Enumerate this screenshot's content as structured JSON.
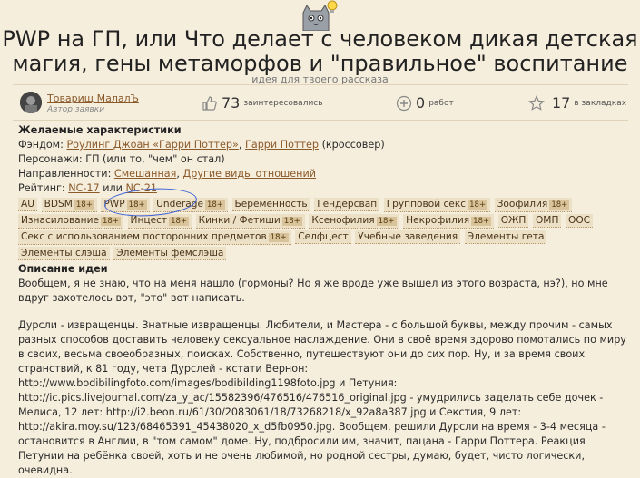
{
  "header": {
    "title": "PWP на ГП, или Что делает с человеком дикая детская магия, гены метаморфов и \"правильное\" воспитание",
    "subtitle": "идея для твоего рассказа"
  },
  "author": {
    "name": "Товарищ МалалЪ",
    "role": "Автор заявки"
  },
  "stats": {
    "interested_count": "73",
    "interested_label": "заинтересовались",
    "works_count": "0",
    "works_label": "работ",
    "bookmarks_count": "17",
    "bookmarks_label": "в закладках"
  },
  "details": {
    "section_title": "Желаемые характеристики",
    "fandom_label": "Фэндом:",
    "fandom_link1": "Роулинг Джоан «Гарри Поттер»",
    "fandom_sep": ",",
    "fandom_link2": "Гарри Поттер",
    "fandom_suffix": "(кроссовер)",
    "characters_label": "Персонажи:",
    "characters_value": "ГП (или то, \"чем\" он стал)",
    "direction_label": "Направленности:",
    "direction_link1": "Смешанная",
    "direction_link2": "Другие виды отношений",
    "rating_label": "Рейтинг:",
    "rating_link1": "NC-17",
    "rating_or": "или",
    "rating_link2": "NC-21"
  },
  "tags": [
    {
      "label": "AU",
      "age": ""
    },
    {
      "label": "BDSM",
      "age": "18+"
    },
    {
      "label": "PWP",
      "age": "18+"
    },
    {
      "label": "Underage",
      "age": "18+"
    },
    {
      "label": "Беременность",
      "age": ""
    },
    {
      "label": "Гендерсвап",
      "age": ""
    },
    {
      "label": "Групповой секс",
      "age": "18+"
    },
    {
      "label": "Зоофилия",
      "age": "18+"
    },
    {
      "label": "Изнасилование",
      "age": "18+"
    },
    {
      "label": "Инцест",
      "age": "18+"
    },
    {
      "label": "Кинки / Фетиши",
      "age": "18+"
    },
    {
      "label": "Ксенофилия",
      "age": "18+"
    },
    {
      "label": "Некрофилия",
      "age": "18+"
    },
    {
      "label": "ОЖП",
      "age": ""
    },
    {
      "label": "ОМП",
      "age": ""
    },
    {
      "label": "ООС",
      "age": ""
    },
    {
      "label": "Секс с использованием посторонних предметов",
      "age": "18+"
    },
    {
      "label": "Селфцест",
      "age": ""
    },
    {
      "label": "Учебные заведения",
      "age": ""
    },
    {
      "label": "Элементы гета",
      "age": ""
    },
    {
      "label": "Элементы слэша",
      "age": ""
    },
    {
      "label": "Элементы фемслэша",
      "age": ""
    }
  ],
  "description": {
    "title": "Описание идеи",
    "para1": "Вообщем, я не знаю, что на меня нашло (гормоны? Но я же вроде уже вышел из этого возраста, нэ?), но мне вдруг захотелось вот, \"это\" вот написать.",
    "para2": "Дурсли - извращенцы. Знатные извращенцы. Любители, и Мастера - с большой буквы, между прочим - самых разных способов доставить человеку сексуальное наслаждение. Они в своё время здорово помотались по миру в своих, весьма своеобразных, поисках. Собственно, путешествуют они до сих пор. Ну, и за время своих странствий, к 81 году, чета Дурслей - кстати Вернон: http://www.bodibilingfoto.com/images/bodibilding1198foto.jpg и Петуния: http://ic.pics.livejournal.com/za_y_ac/15582396/476516/476516_original.jpg - умудрились заделать себе дочек - Мелиса, 12 лет: http://i2.beon.ru/61/30/2083061/18/73268218/x_92a8a387.jpg и Секстия, 9 лет: http://akira.moy.su/123/68465391_45438020_x_d5fb0950.jpg. Вообщем, решили Дурсли на время - 3-4 месяца - остановится в Англии, в \"том самом\" доме. Ну, подбросили им, значит, пацана - Гарри Поттера. Реакция Петунии на ребёнка своей, хоть и не очень любимой, но родной сестры, думаю, будет, чисто логически, очевидна."
  }
}
